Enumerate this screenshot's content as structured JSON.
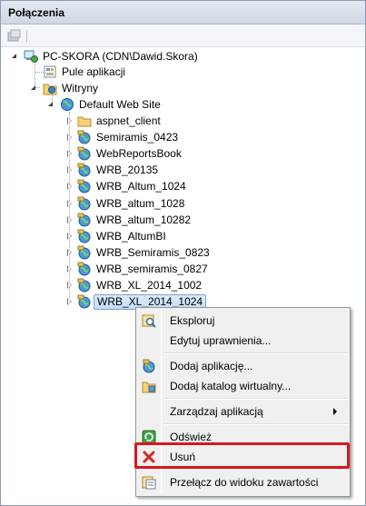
{
  "panel": {
    "title": "Połączenia"
  },
  "tree": {
    "root": {
      "label": "PC-SKORA (CDN\\Dawid.Skora)"
    },
    "app_pools": {
      "label": "Pule aplikacji"
    },
    "sites": {
      "label": "Witryny"
    },
    "default_site": {
      "label": "Default Web Site"
    },
    "children": [
      {
        "label": "aspnet_client",
        "icon": "folder-icon"
      },
      {
        "label": "Semiramis_0423",
        "icon": "web-app-icon"
      },
      {
        "label": "WebReportsBook",
        "icon": "web-app-icon"
      },
      {
        "label": "WRB_20135",
        "icon": "web-app-icon"
      },
      {
        "label": "WRB_Altum_1024",
        "icon": "web-app-icon"
      },
      {
        "label": "WRB_altum_1028",
        "icon": "web-app-icon"
      },
      {
        "label": "WRB_altum_10282",
        "icon": "web-app-icon"
      },
      {
        "label": "WRB_AltumBI",
        "icon": "web-app-icon"
      },
      {
        "label": "WRB_Semiramis_0823",
        "icon": "web-app-icon"
      },
      {
        "label": "WRB_semiramis_0827",
        "icon": "web-app-icon"
      },
      {
        "label": "WRB_XL_2014_1002",
        "icon": "web-app-icon"
      },
      {
        "label": "WRB_XL_2014_1024",
        "icon": "web-app-icon",
        "selected": true
      }
    ]
  },
  "context_menu": {
    "items": [
      {
        "label": "Eksploruj",
        "icon": "explore-icon"
      },
      {
        "label": "Edytuj uprawnienia...",
        "icon": ""
      },
      {
        "label": "Dodaj aplikację...",
        "icon": "add-app-icon"
      },
      {
        "label": "Dodaj katalog wirtualny...",
        "icon": "add-virtual-dir-icon"
      },
      {
        "label": "Zarządzaj aplikacją",
        "icon": "",
        "submenu": true
      },
      {
        "label": "Odśwież",
        "icon": "refresh-icon"
      },
      {
        "label": "Usuń",
        "icon": "delete-icon",
        "highlighted": true
      },
      {
        "label": "Przełącz do widoku zawartości",
        "icon": "content-view-icon"
      }
    ]
  },
  "colors": {
    "highlight_border": "#d9171d",
    "selection": "#c4ddfa"
  }
}
